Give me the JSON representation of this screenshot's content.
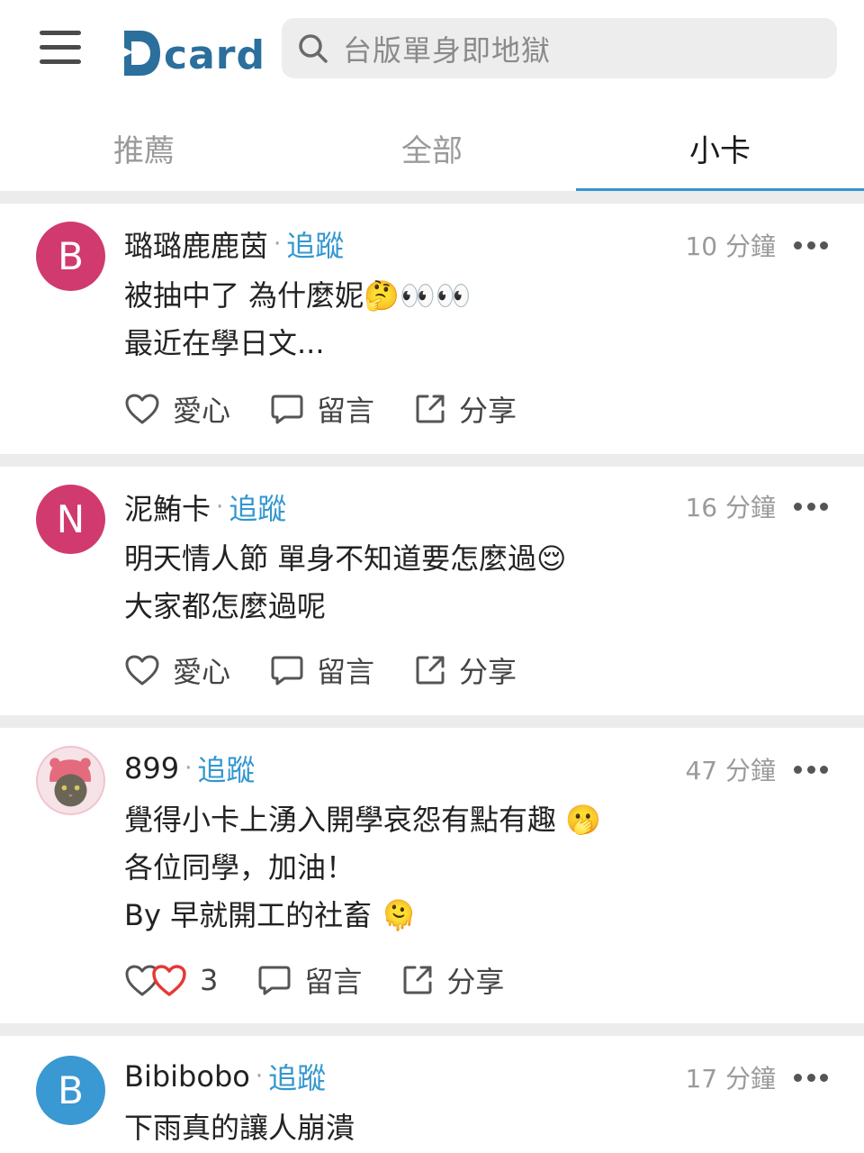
{
  "header": {
    "logo_text": "card",
    "search_placeholder": "台版單身即地獄"
  },
  "tabs": [
    {
      "label": "推薦",
      "active": false
    },
    {
      "label": "全部",
      "active": false
    },
    {
      "label": "小卡",
      "active": true
    }
  ],
  "colors": {
    "accent": "#3397cf",
    "logo": "#2b6f9c",
    "avatar_pink": "#d13a6e",
    "avatar_blue": "#3a98d2"
  },
  "actions": {
    "like": "愛心",
    "comment": "留言",
    "share": "分享"
  },
  "posts": [
    {
      "avatar_letter": "B",
      "author": "璐璐鹿鹿茵",
      "separator": "·",
      "follow": "追蹤",
      "time": "10 分鐘",
      "lines": [
        "被抽中了 為什麼妮🤔👀👀",
        "最近在學日文..."
      ],
      "likes": ""
    },
    {
      "avatar_letter": "N",
      "author": "泥鮪卡",
      "separator": "·",
      "follow": "追蹤",
      "time": "16 分鐘",
      "lines": [
        "明天情人節 單身不知道要怎麼過😌",
        "大家都怎麼過呢"
      ],
      "likes": ""
    },
    {
      "avatar_letter": "",
      "author": "899",
      "separator": "·",
      "follow": "追蹤",
      "time": "47 分鐘",
      "lines": [
        "覺得小卡上湧入開學哀怨有點有趣 🫢",
        "各位同學，加油！",
        "By 早就開工的社畜 🫠"
      ],
      "likes": "3"
    },
    {
      "avatar_letter": "B",
      "author": "Bibibobo",
      "separator": "·",
      "follow": "追蹤",
      "time": "17 分鐘",
      "lines": [
        "下雨真的讓人崩潰"
      ],
      "likes": ""
    }
  ]
}
